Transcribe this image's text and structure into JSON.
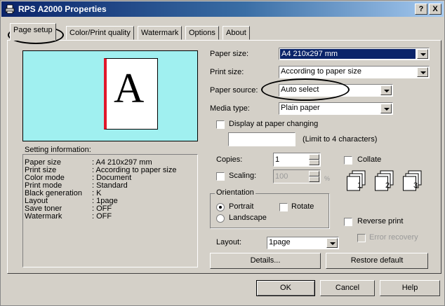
{
  "window": {
    "title": "RPS A2000 Properties",
    "help_label": "?",
    "close_label": "X"
  },
  "tabs": [
    {
      "label": "Page setup",
      "active": true
    },
    {
      "label": "Color/Print quality",
      "active": false
    },
    {
      "label": "Watermark",
      "active": false
    },
    {
      "label": "Options",
      "active": false
    },
    {
      "label": "About",
      "active": false
    }
  ],
  "preview": {
    "letter": "A"
  },
  "fields": {
    "paper_size_label": "Paper size:",
    "paper_size_value": "A4 210x297 mm",
    "print_size_label": "Print size:",
    "print_size_value": "According to paper size",
    "paper_source_label": "Paper source:",
    "paper_source_value": "Auto select",
    "media_type_label": "Media type:",
    "media_type_value": "Plain paper",
    "display_change_label": "Display at paper changing",
    "limit_note": "(Limit to 4 characters)",
    "copies_label": "Copies:",
    "copies_value": "1",
    "collate_label": "Collate",
    "scaling_label": "Scaling:",
    "scaling_value": "100",
    "scaling_unit": "%",
    "orientation_label": "Orientation",
    "portrait_label": "Portrait",
    "landscape_label": "Landscape",
    "rotate_label": "Rotate",
    "reverse_print_label": "Reverse print",
    "error_recovery_label": "Error recovery",
    "layout_label": "Layout:",
    "layout_value": "1page"
  },
  "setting_info": {
    "title": "Setting information:",
    "rows": [
      {
        "key": "Paper size",
        "value": ": A4 210x297 mm"
      },
      {
        "key": "Print size",
        "value": ": According to paper size"
      },
      {
        "key": "Color mode",
        "value": ": Document"
      },
      {
        "key": "Print mode",
        "value": ": Standard"
      },
      {
        "key": "Black generation",
        "value": ": K"
      },
      {
        "key": "Layout",
        "value": ": 1page"
      },
      {
        "key": "Save toner",
        "value": ": OFF"
      },
      {
        "key": "Watermark",
        "value": ": OFF"
      }
    ]
  },
  "buttons": {
    "details": "Details...",
    "restore_default": "Restore default",
    "ok": "OK",
    "cancel": "Cancel",
    "help": "Help"
  },
  "collate_pages": [
    "1",
    "2",
    "3"
  ],
  "colors": {
    "preview_bg": "#a0f0f0",
    "page_margin_red": "#e0182c",
    "selection_blue": "#0a246a"
  }
}
